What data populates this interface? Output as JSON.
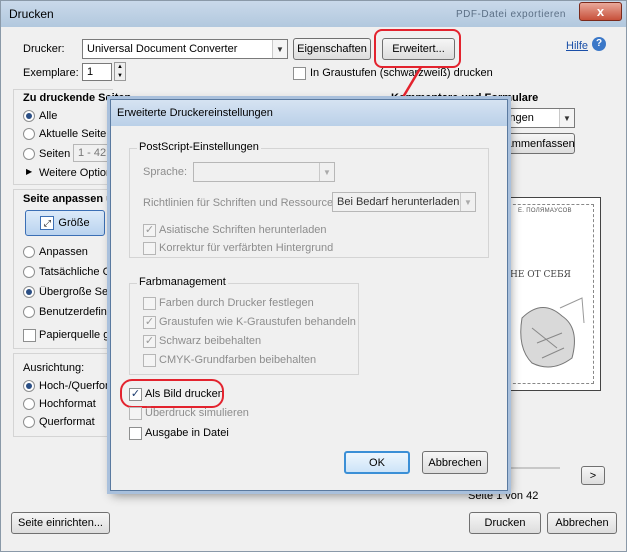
{
  "window": {
    "title": "Drucken",
    "background_title": "PDF-Datei exportieren",
    "close_label": "x"
  },
  "printer": {
    "label": "Drucker:",
    "selected": "Universal Document Converter",
    "properties_button": "Eigenschaften",
    "advanced_button": "Erweitert...",
    "help_link": "Hilfe",
    "copies_label": "Exemplare:",
    "copies_value": "1",
    "grayscale_label": "In Graustufen (schwarzweiß) drucken"
  },
  "pages_section": {
    "title": "Zu druckende Seiten",
    "options": [
      "Alle",
      "Aktuelle Seite",
      "Seiten"
    ],
    "selected_index": 0,
    "range_value": "1 - 42",
    "more_options": "Weitere Optionen"
  },
  "comments_section": {
    "title": "Kommentare und Formulare",
    "selected": "Dokument und Markierungen",
    "summarize_button": "Zusammenfassen"
  },
  "sizing_section": {
    "title": "Seite anpassen und Optionen",
    "size_button": "Größe",
    "options": [
      "Anpassen",
      "Tatsächliche Größe",
      "Übergroße Seiten verkleinern",
      "Benutzerdefinierter Maßstab"
    ],
    "selected_index": 2,
    "paper_source_label": "Papierquelle gemäß PDF-Seitengröße auswählen"
  },
  "orientation_section": {
    "title": "Ausrichtung:",
    "options": [
      "Hoch-/Querformat automatisch",
      "Hochformat",
      "Querformat"
    ],
    "selected_index": 0
  },
  "preview": {
    "book_author": "Е. ПОЛЯМАУСОВ",
    "book_title": "НЕ ОТ СЕБЯ",
    "page_status": "Seite 1 von 42",
    "next_label": ">"
  },
  "footer": {
    "page_setup_button": "Seite einrichten...",
    "print_button": "Drucken",
    "cancel_button": "Abbrechen"
  },
  "dialog": {
    "title": "Erweiterte Druckereinstellungen",
    "postscript": {
      "title": "PostScript-Einstellungen",
      "language_label": "Sprache:",
      "language_value": "",
      "font_policy_label": "Richtlinien für Schriften und Ressourcen:",
      "font_policy_value": "Bei Bedarf herunterladen",
      "checks": [
        {
          "label": "Asiatische Schriften herunterladen",
          "checked": true
        },
        {
          "label": "Korrektur für verfärbten Hintergrund",
          "checked": false
        }
      ]
    },
    "color": {
      "title": "Farbmanagement",
      "checks": [
        {
          "label": "Farben durch Drucker festlegen",
          "checked": false
        },
        {
          "label": "Graustufen wie K-Graustufen behandeln",
          "checked": true
        },
        {
          "label": "Schwarz beibehalten",
          "checked": true
        },
        {
          "label": "CMYK-Grundfarben beibehalten",
          "checked": false
        }
      ]
    },
    "print_as_image": {
      "label": "Als Bild drucken",
      "checked": true
    },
    "simulate_overprint": {
      "label": "Überdruck simulieren",
      "checked": false
    },
    "print_to_file": {
      "label": "Ausgabe in Datei",
      "checked": false
    },
    "ok_button": "OK",
    "cancel_button": "Abbrechen"
  },
  "colors": {
    "annotation_red": "#e3232e",
    "help_blue": "#1a4fa8",
    "selected_button": "#3b6fb5"
  }
}
